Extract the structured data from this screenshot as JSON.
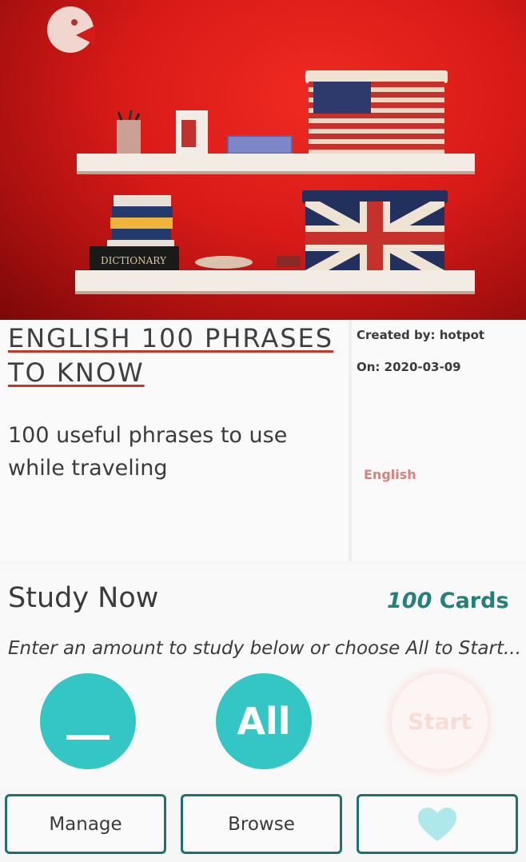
{
  "deck": {
    "title": "ENGLISH 100 PHRASES TO KNOW",
    "description": "100 useful phrases to use while traveling",
    "created_by": "Created by: hotpot",
    "created_on": "On: 2020-03-09",
    "language": "English"
  },
  "hero": {
    "book_spine_text": "DICTIONARY",
    "icons": [
      "logo-icon",
      "american-flag-box",
      "union-jack-box"
    ]
  },
  "study": {
    "title": "Study Now",
    "card_count": "100",
    "card_label": " Cards",
    "hint": "Enter an amount to study below or choose All to Start...",
    "all_label": "All",
    "start_label": "Start"
  },
  "actions": {
    "manage_label": "Manage",
    "browse_label": "Browse",
    "favorite_icon": "heart-icon"
  },
  "colors": {
    "accent_teal": "#33c6c4",
    "dark_teal": "#1f7070",
    "count_teal": "#24807a",
    "title_underline": "#c0392b",
    "language_tag": "#d98080"
  }
}
